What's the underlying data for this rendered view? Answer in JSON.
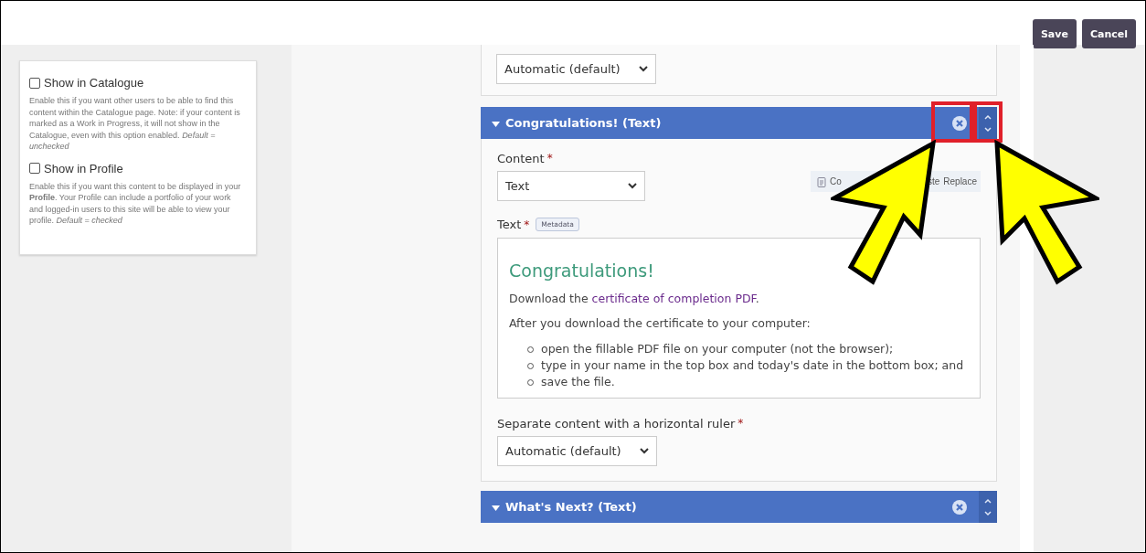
{
  "toolbar": {
    "buttons": [
      {
        "label": "Save"
      },
      {
        "label": "Cancel"
      }
    ]
  },
  "sidebar": {
    "options": [
      {
        "label": "Show in Catalogue",
        "checked": false,
        "help": "Enable this if you want other users to be able to find this content within the Catalogue page. Note: if your content is marked as a Work in Progress, it will not show in the Catalogue, even with this option enabled. *Default = unchecked*"
      },
      {
        "label": "Show in Profile",
        "checked": false,
        "help": "Enable this if you want this content to be displayed in your **Profile**. Your Profile can include a portfolio of your work and logged-in users to this site will be able to view your profile. *Default = checked*"
      }
    ]
  },
  "previous_section": {
    "select_value": "Automatic (default)"
  },
  "section": {
    "title": "Congratulations! (Text)",
    "expanded": true,
    "content_label": "Content",
    "content_required": "*",
    "content_value": "Text",
    "copy_button_parts": [
      "Co",
      "ste",
      "Replace"
    ],
    "text_label": "Text",
    "text_required": "*",
    "metadata_button": "Metadata",
    "editor": {
      "heading": "Congratulations!",
      "intro": "Download the ",
      "link": "certificate of completion PDF",
      "intro_end": ".",
      "after": "After you download the certificate to your computer:",
      "steps": [
        "open the fillable PDF file on your computer (not the browser);",
        "type in your name in the top box and today's date in the bottom box; and",
        "save the file."
      ]
    },
    "ruler_label": "Separate content with a horizontal ruler",
    "ruler_required": "*",
    "ruler_value": "Automatic (default)"
  },
  "next_section": {
    "title": "What's Next? (Text)",
    "expanded": true
  }
}
